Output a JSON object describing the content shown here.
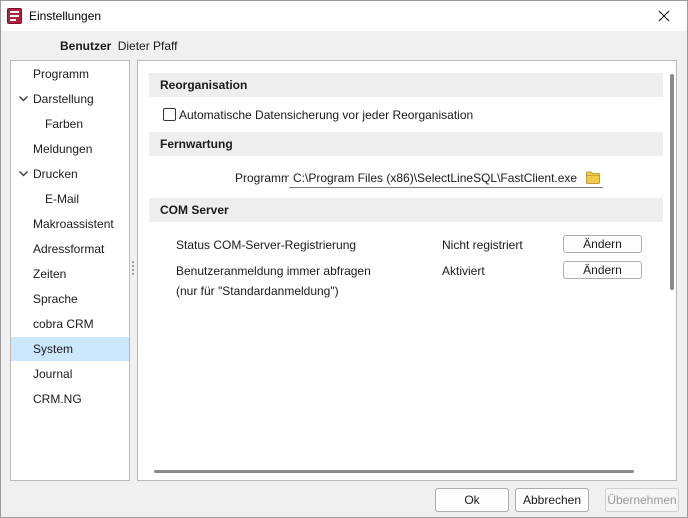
{
  "window": {
    "title": "Einstellungen",
    "app_icon": "selectline-app-icon"
  },
  "user": {
    "label": "Benutzer",
    "value": "Dieter Pfaff"
  },
  "nav": {
    "items": [
      {
        "label": "Programm"
      },
      {
        "label": "Darstellung",
        "expanded": true
      },
      {
        "label": "Farben"
      },
      {
        "label": "Meldungen"
      },
      {
        "label": "Drucken",
        "expanded": true
      },
      {
        "label": "E-Mail"
      },
      {
        "label": "Makroassistent"
      },
      {
        "label": "Adressformat"
      },
      {
        "label": "Zeiten"
      },
      {
        "label": "Sprache"
      },
      {
        "label": "cobra CRM"
      },
      {
        "label": "System",
        "selected": true
      },
      {
        "label": "Journal"
      },
      {
        "label": "CRM.NG"
      }
    ]
  },
  "sections": {
    "reorg": {
      "title": "Reorganisation",
      "checkbox_label": "Automatische Datensicherung vor jeder Reorganisation",
      "checked": false
    },
    "fernwartung": {
      "title": "Fernwartung",
      "program_label": "Programm",
      "program_path": "C:\\Program Files (x86)\\SelectLineSQL\\FastClient.exe"
    },
    "com": {
      "title": "COM Server",
      "status_label": "Status COM-Server-Registrierung",
      "status_value": "Nicht registriert",
      "status_button": "Ändern",
      "login_label": "Benutzeranmeldung immer abfragen",
      "login_sublabel": "(nur für \"Standardanmeldung\")",
      "login_value": "Aktiviert",
      "login_button": "Ändern"
    }
  },
  "footer": {
    "ok": "Ok",
    "cancel": "Abbrechen",
    "apply": "Übernehmen"
  },
  "colors": {
    "selection": "#cce8ff",
    "section_bg": "#eeeeee",
    "folder": "#f2c94c"
  }
}
